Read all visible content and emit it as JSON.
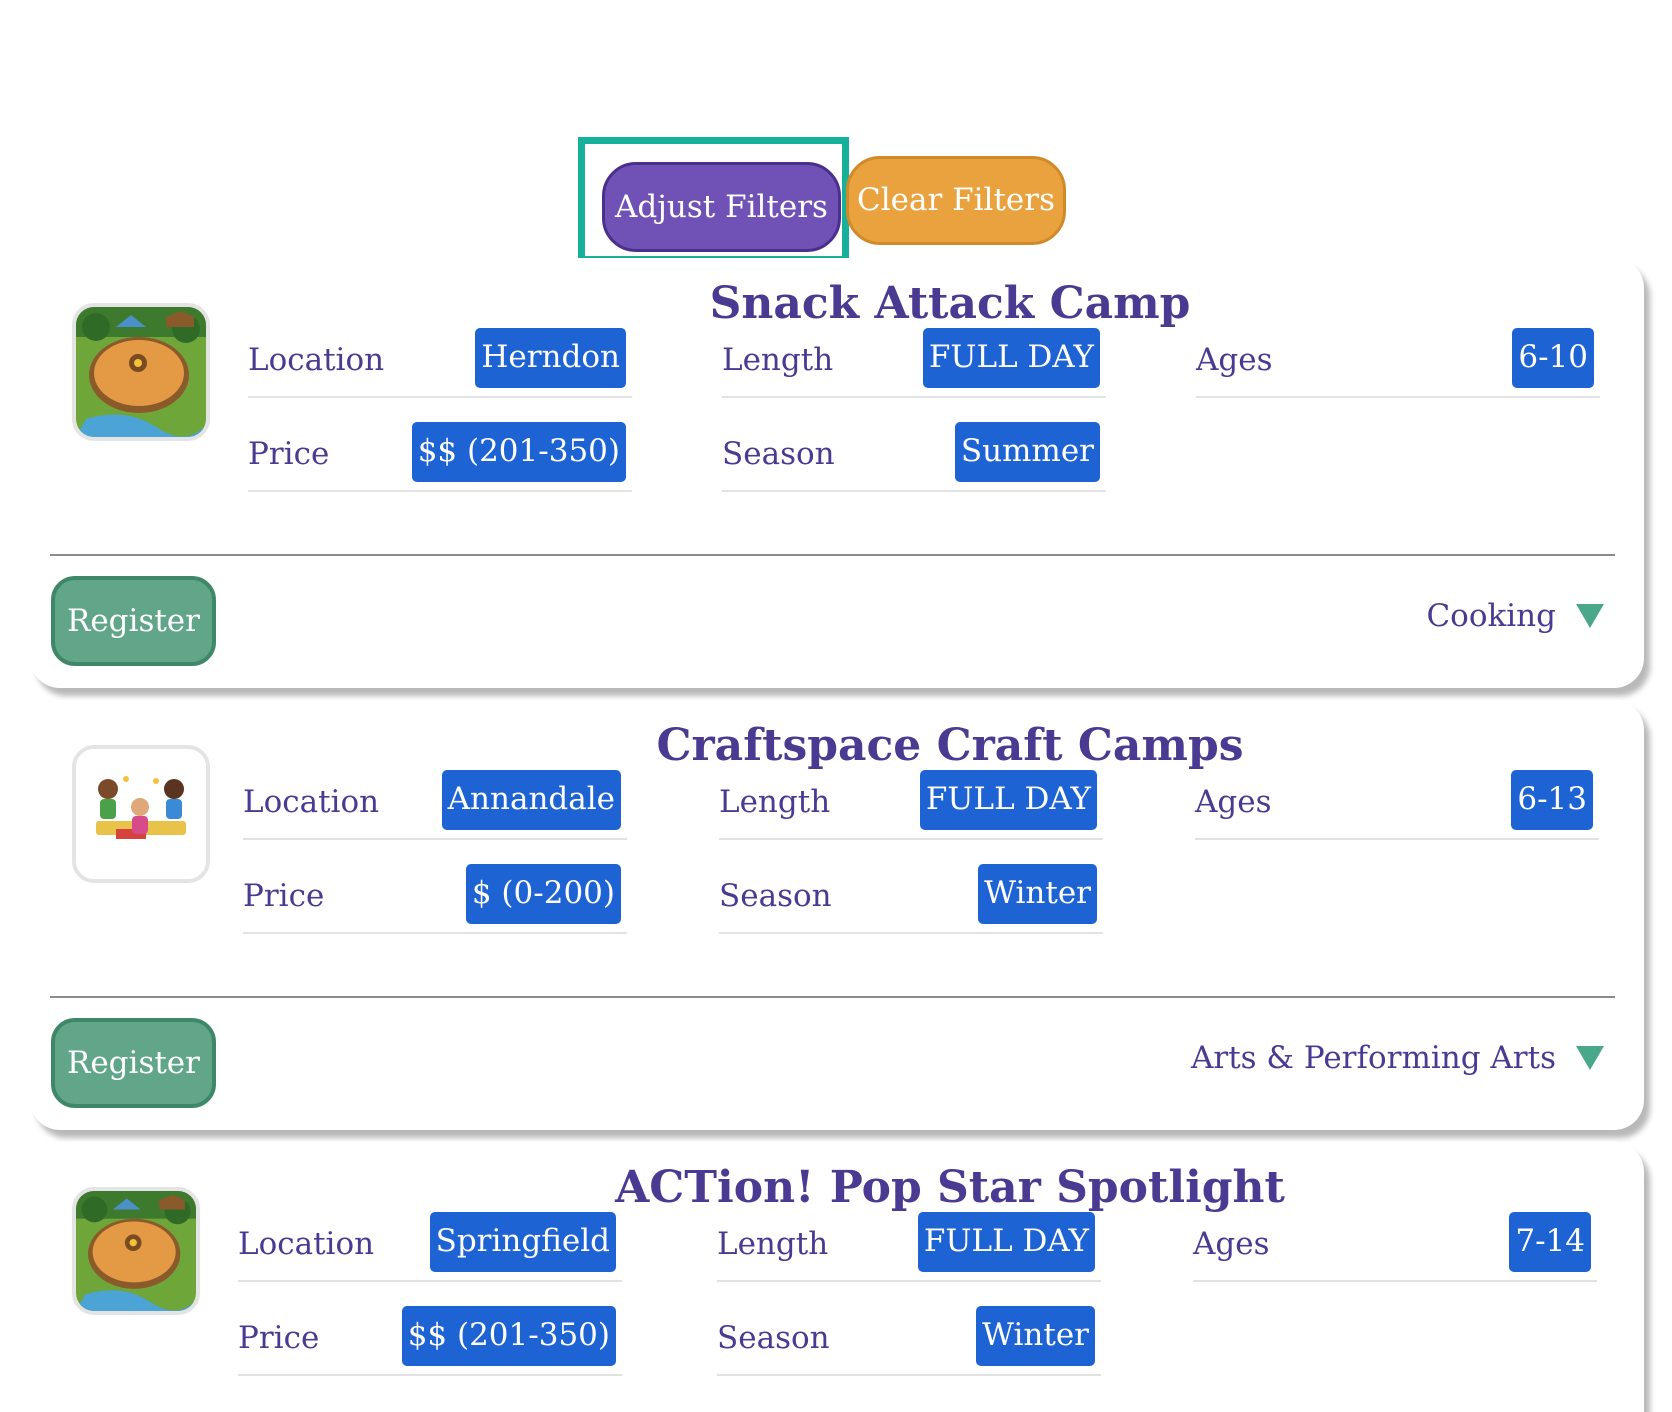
{
  "filters": {
    "adjust_label": "Adjust Filters",
    "clear_label": "Clear Filters"
  },
  "labels": {
    "location": "Location",
    "length": "Length",
    "ages": "Ages",
    "price": "Price",
    "season": "Season",
    "register": "Register"
  },
  "colors": {
    "title": "#4b3a91",
    "badge": "#1e63d4",
    "register": "#62a68a",
    "adjust": "#7051b6",
    "clear": "#eaa23e",
    "highlight": "#17b09a"
  },
  "camps": [
    {
      "title": "Snack Attack Camp",
      "image_icon": "campground-icon",
      "location": "Herndon",
      "length": "FULL DAY",
      "ages": "6-10",
      "price": "$$ (201-350)",
      "season": "Summer",
      "category": "Cooking"
    },
    {
      "title": "Craftspace Craft Camps",
      "image_icon": "kids-crafting-icon",
      "location": "Annandale",
      "length": "FULL DAY",
      "ages": "6-13",
      "price": "$ (0-200)",
      "season": "Winter",
      "category": "Arts & Performing Arts"
    },
    {
      "title": "ACTion! Pop Star Spotlight",
      "image_icon": "campground-icon",
      "location": "Springfield",
      "length": "FULL DAY",
      "ages": "7-14",
      "price": "$$ (201-350)",
      "season": "Winter",
      "category": ""
    }
  ]
}
